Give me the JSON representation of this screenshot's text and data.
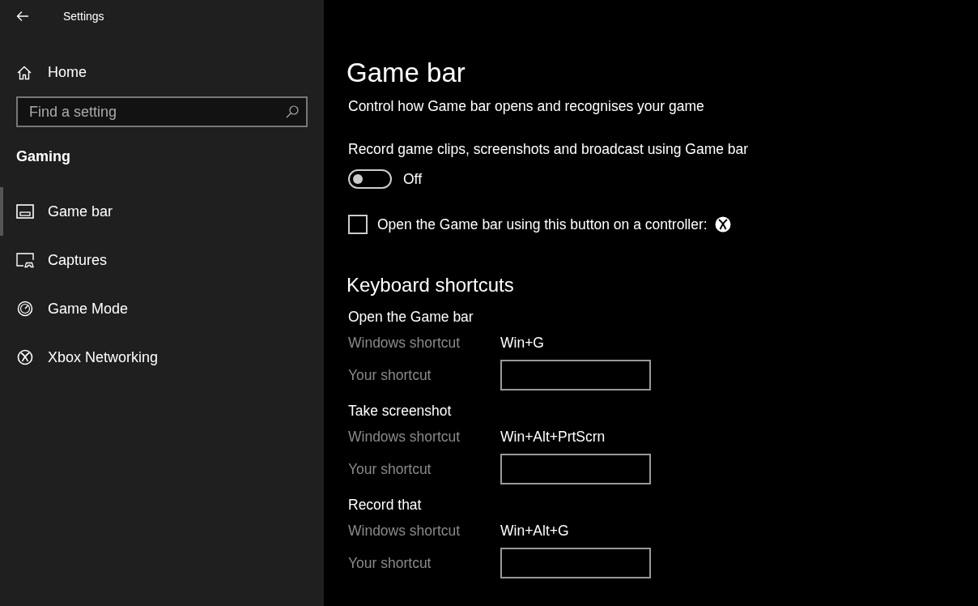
{
  "window": {
    "title": "Settings"
  },
  "sidebar": {
    "home": "Home",
    "search": {
      "placeholder": "Find a setting"
    },
    "section": "Gaming",
    "items": [
      {
        "label": "Game bar",
        "kind": "gamebar",
        "selected": true
      },
      {
        "label": "Captures",
        "kind": "captures",
        "selected": false
      },
      {
        "label": "Game Mode",
        "kind": "gamemode",
        "selected": false
      },
      {
        "label": "Xbox Networking",
        "kind": "xbox",
        "selected": false
      }
    ]
  },
  "page": {
    "title": "Game bar",
    "subtitle": "Control how Game bar opens and recognises your game",
    "record": {
      "label": "Record game clips, screenshots and broadcast using Game bar",
      "on": false,
      "state_text": "Off"
    },
    "controller": {
      "label": "Open the Game bar using this button on a controller:",
      "checked": false
    },
    "shortcuts_heading": "Keyboard shortcuts",
    "shortcuts": [
      {
        "name": "Open the Game bar",
        "windows_label": "Windows shortcut",
        "windows_value": "Win+G",
        "yours_label": "Your shortcut"
      },
      {
        "name": "Take screenshot",
        "windows_label": "Windows shortcut",
        "windows_value": "Win+Alt+PrtScrn",
        "yours_label": "Your shortcut"
      },
      {
        "name": "Record that",
        "windows_label": "Windows shortcut",
        "windows_value": "Win+Alt+G",
        "yours_label": "Your shortcut"
      }
    ]
  }
}
